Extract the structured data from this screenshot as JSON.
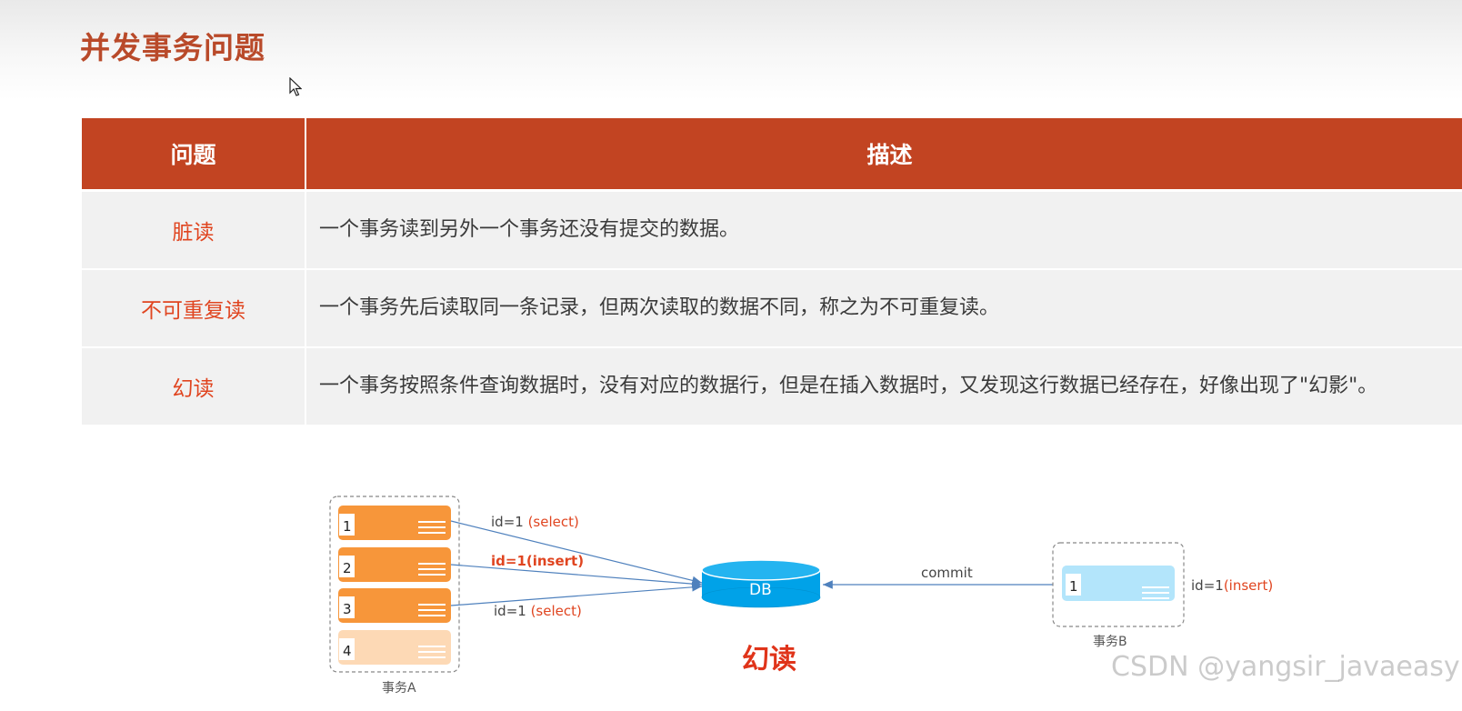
{
  "page": {
    "title": "并发事务问题"
  },
  "table": {
    "headers": {
      "issue": "问题",
      "description": "描述"
    },
    "rows": [
      {
        "issue": "脏读",
        "description": "一个事务读到另外一个事务还没有提交的数据。"
      },
      {
        "issue": "不可重复读",
        "description": "一个事务先后读取同一条记录，但两次读取的数据不同，称之为不可重复读。"
      },
      {
        "issue": "幻读",
        "description": "一个事务按照条件查询数据时，没有对应的数据行，但是在插入数据时，又发现这行数据已经存在，好像出现了\"幻影\"。"
      }
    ]
  },
  "diagram": {
    "transaction_a": {
      "label": "事务A",
      "steps": [
        "1",
        "2",
        "3",
        "4"
      ]
    },
    "transaction_b": {
      "label": "事务B",
      "step": "1",
      "side_label_prefix": "id=1",
      "side_label_op": "(insert)"
    },
    "db_label": "DB",
    "commit_label": "commit",
    "edges": [
      {
        "prefix": "id=1 ",
        "op": "(select)"
      },
      {
        "full": "id=1(insert)"
      },
      {
        "prefix": "id=1 ",
        "op": "(select)"
      }
    ],
    "caption": "幻读"
  },
  "watermark": "CSDN @yangsir_javaeasy",
  "colors": {
    "accent": "#c24422",
    "issue_text": "#e04520",
    "step_orange": "#f7963a",
    "step_light": "#fdd9b5",
    "db_blue": "#00a2e8",
    "b_card": "#b3e5fb",
    "edge": "#4f81bd"
  }
}
